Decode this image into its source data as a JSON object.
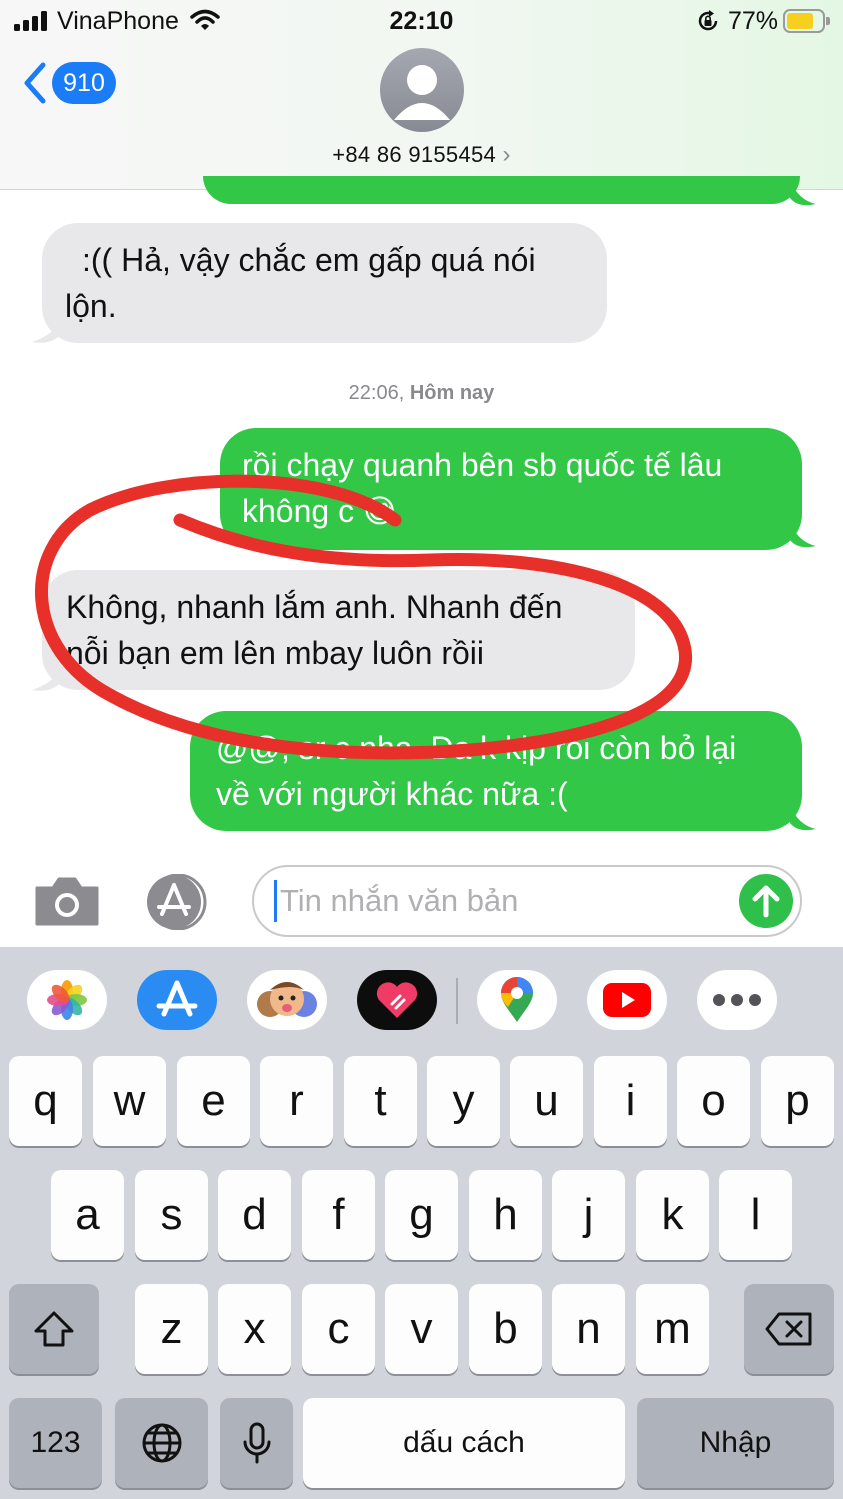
{
  "status_bar": {
    "carrier": "VinaPhone",
    "time": "22:10",
    "battery_percent": "77%",
    "battery_level": 0.77,
    "battery_color": "#f7cf1f"
  },
  "header": {
    "back_badge_count": "910",
    "contact_number": "+84 86 9155454",
    "contact_chevron": "›"
  },
  "messages": [
    {
      "direction": "incoming",
      "lines": [
        ":(( Hả, vậy chắc em gấp quá nói",
        "lộn."
      ]
    },
    {
      "direction": "outgoing",
      "lines": [
        "rồi chạy quanh bên sb quốc tế lâu",
        "không c 😅"
      ]
    },
    {
      "direction": "incoming",
      "lines": [
        "Không, nhanh lắm anh. Nhanh đến",
        "nỗi bạn em lên mbay luôn rồii"
      ]
    },
    {
      "direction": "outgoing",
      "lines": [
        "@@, sr c nha. Đa k kịp rồi còn bỏ lại",
        "về với người khác nữa :("
      ]
    }
  ],
  "timestamp": {
    "time": "22:06,",
    "day": "Hôm nay"
  },
  "compose": {
    "placeholder": "Tin nhắn văn bản",
    "camera_icon": "camera-icon",
    "apps_icon": "app-store-icon"
  },
  "app_strip": [
    "photos-icon",
    "app-store-icon",
    "memoji-icon",
    "digital-touch-icon",
    "google-maps-icon",
    "youtube-icon",
    "more-icon"
  ],
  "keyboard": {
    "row1": [
      "q",
      "w",
      "e",
      "r",
      "t",
      "y",
      "u",
      "i",
      "o",
      "p"
    ],
    "row2": [
      "a",
      "s",
      "d",
      "f",
      "g",
      "h",
      "j",
      "k",
      "l"
    ],
    "row3": [
      "z",
      "x",
      "c",
      "v",
      "b",
      "n",
      "m"
    ],
    "numbers_key": "123",
    "space_key": "dấu cách",
    "return_key": "Nhập"
  },
  "colors": {
    "outgoing_bubble": "#33c748",
    "incoming_bubble": "#e8e8eb",
    "accent_blue": "#1b7cf7",
    "annotation_red": "#e8302a"
  }
}
